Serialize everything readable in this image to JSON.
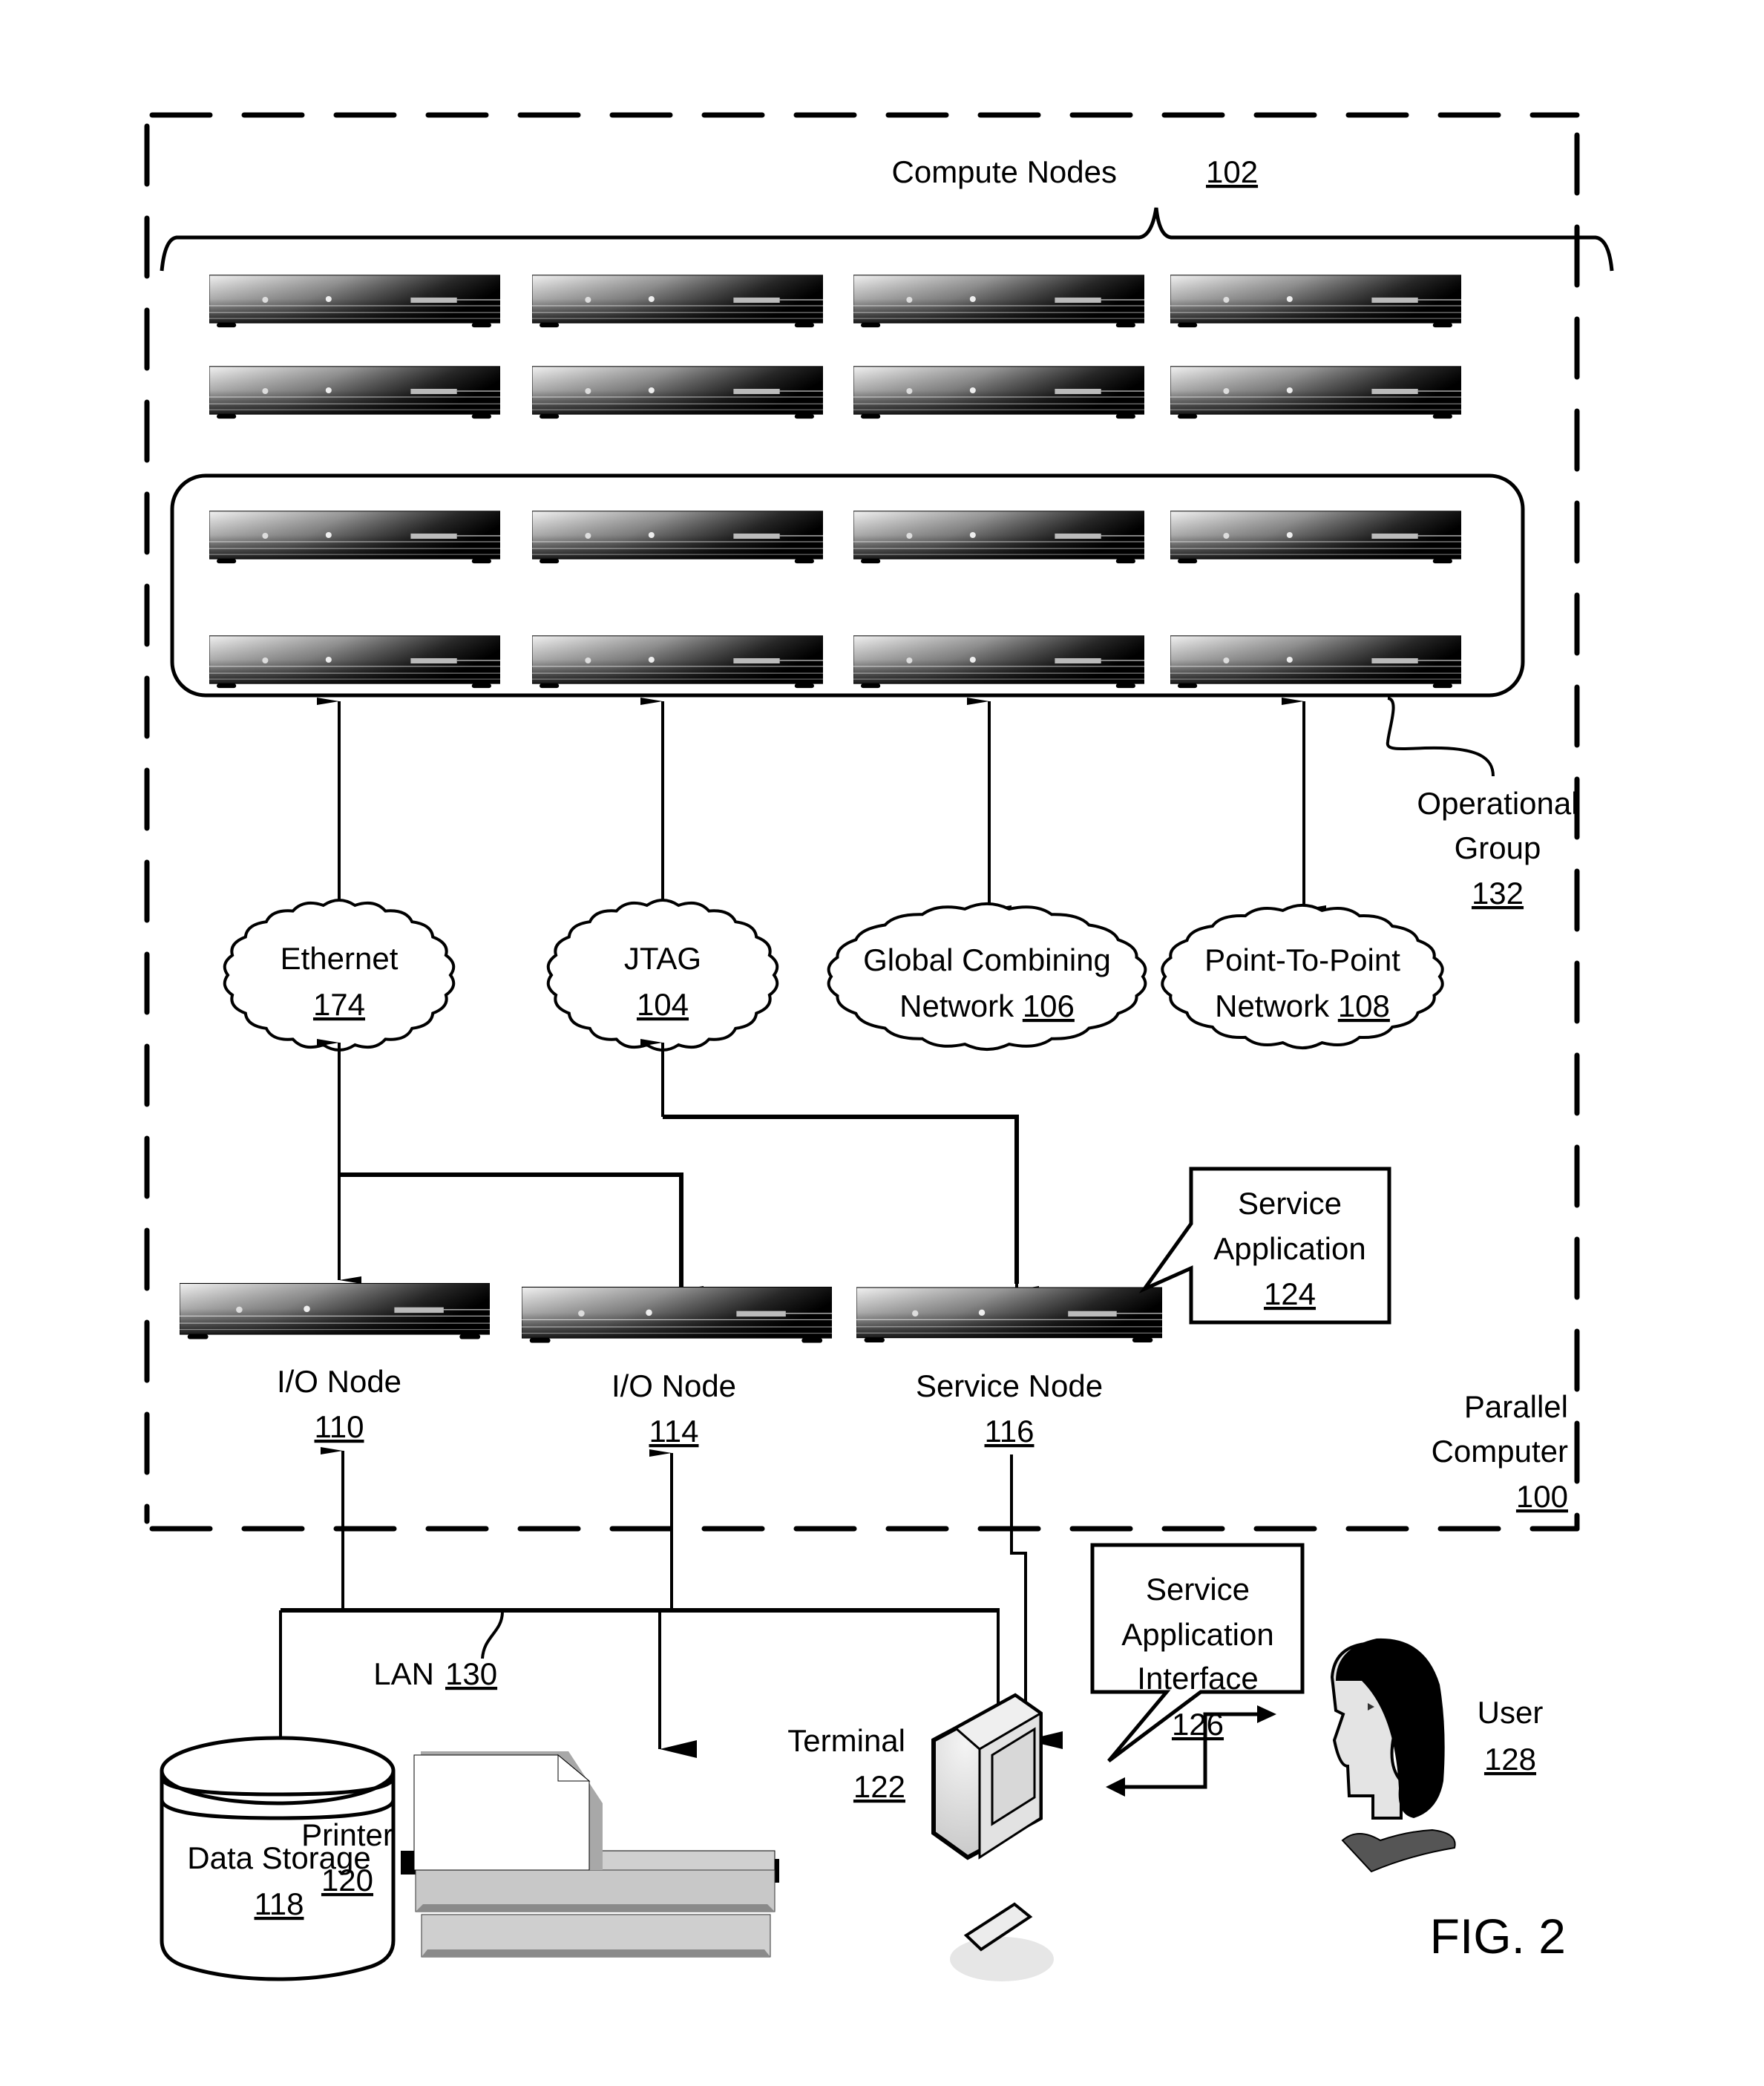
{
  "figure": {
    "label": "FIG. 2",
    "parallel_computer": {
      "title_line1": "Parallel",
      "title_line2": "Computer",
      "ref": "100"
    },
    "compute_nodes": {
      "title": "Compute Nodes",
      "ref": "102",
      "rows": 4,
      "cols": 4
    },
    "operational_group": {
      "title_line1": "Operational",
      "title_line2": "Group",
      "ref": "132"
    },
    "networks": [
      {
        "id": "ethernet",
        "line1": "Ethernet",
        "line2": "",
        "ref": "174"
      },
      {
        "id": "jtag",
        "line1": "JTAG",
        "line2": "",
        "ref": "104"
      },
      {
        "id": "global-combining",
        "line1": "Global Combining",
        "line2": "Network",
        "ref": "106"
      },
      {
        "id": "point-to-point",
        "line1": "Point-To-Point",
        "line2": "Network",
        "ref": "108"
      }
    ],
    "nodes": [
      {
        "id": "io-node-1",
        "title": "I/O Node",
        "ref": "110"
      },
      {
        "id": "io-node-2",
        "title": "I/O Node",
        "ref": "114"
      },
      {
        "id": "service-node",
        "title": "Service Node",
        "ref": "116"
      }
    ],
    "service_application": {
      "line1": "Service",
      "line2": "Application",
      "ref": "124"
    },
    "service_application_interface": {
      "line1": "Service",
      "line2": "Application",
      "line3": "Interface",
      "ref": "126"
    },
    "lan": {
      "title": "LAN",
      "ref": "130"
    },
    "data_storage": {
      "title": "Data Storage",
      "ref": "118"
    },
    "printer": {
      "title": "Printer",
      "ref": "120"
    },
    "terminal": {
      "title": "Terminal",
      "ref": "122"
    },
    "user": {
      "title": "User",
      "ref": "128"
    }
  }
}
